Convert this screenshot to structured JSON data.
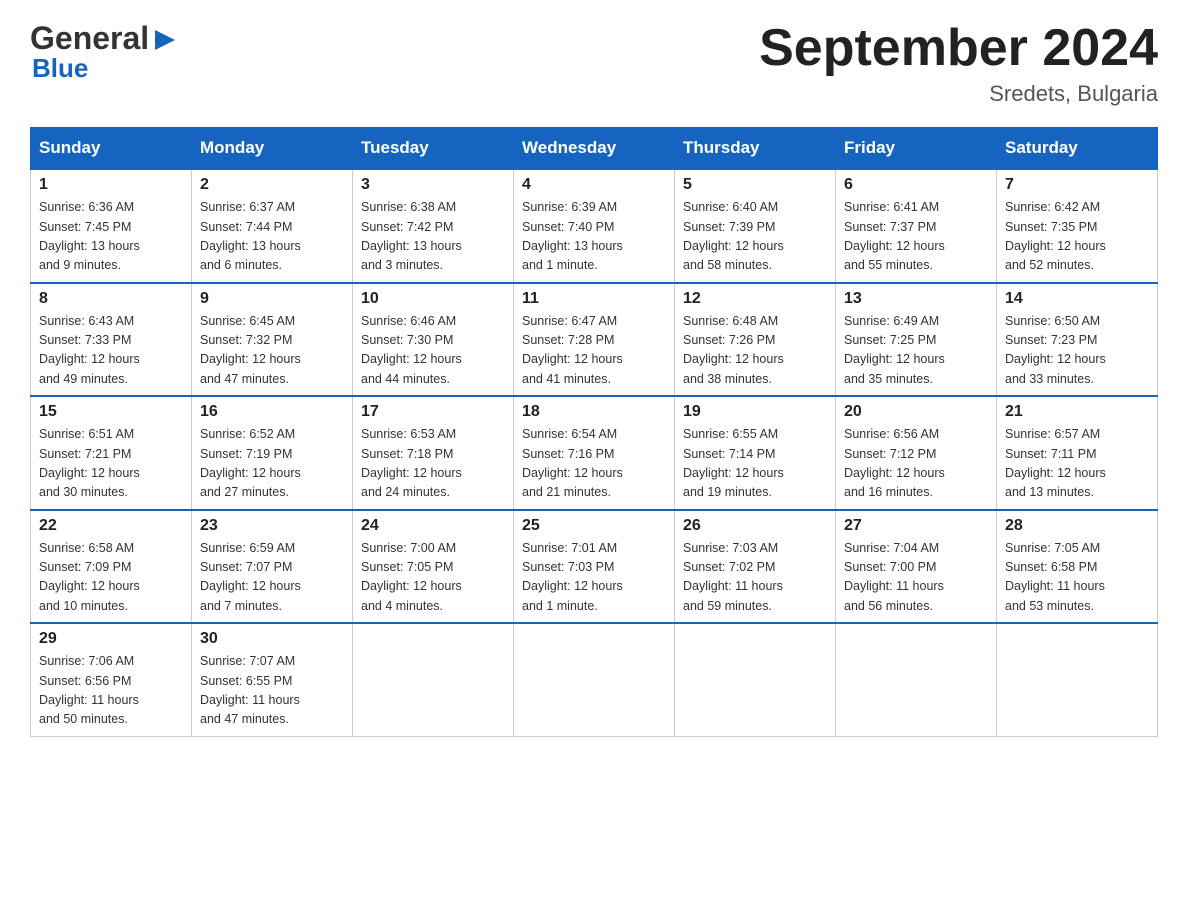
{
  "header": {
    "logo_general": "General",
    "logo_blue": "Blue",
    "title": "September 2024",
    "location": "Sredets, Bulgaria"
  },
  "weekdays": [
    "Sunday",
    "Monday",
    "Tuesday",
    "Wednesday",
    "Thursday",
    "Friday",
    "Saturday"
  ],
  "weeks": [
    [
      {
        "day": "1",
        "info": "Sunrise: 6:36 AM\nSunset: 7:45 PM\nDaylight: 13 hours\nand 9 minutes."
      },
      {
        "day": "2",
        "info": "Sunrise: 6:37 AM\nSunset: 7:44 PM\nDaylight: 13 hours\nand 6 minutes."
      },
      {
        "day": "3",
        "info": "Sunrise: 6:38 AM\nSunset: 7:42 PM\nDaylight: 13 hours\nand 3 minutes."
      },
      {
        "day": "4",
        "info": "Sunrise: 6:39 AM\nSunset: 7:40 PM\nDaylight: 13 hours\nand 1 minute."
      },
      {
        "day": "5",
        "info": "Sunrise: 6:40 AM\nSunset: 7:39 PM\nDaylight: 12 hours\nand 58 minutes."
      },
      {
        "day": "6",
        "info": "Sunrise: 6:41 AM\nSunset: 7:37 PM\nDaylight: 12 hours\nand 55 minutes."
      },
      {
        "day": "7",
        "info": "Sunrise: 6:42 AM\nSunset: 7:35 PM\nDaylight: 12 hours\nand 52 minutes."
      }
    ],
    [
      {
        "day": "8",
        "info": "Sunrise: 6:43 AM\nSunset: 7:33 PM\nDaylight: 12 hours\nand 49 minutes."
      },
      {
        "day": "9",
        "info": "Sunrise: 6:45 AM\nSunset: 7:32 PM\nDaylight: 12 hours\nand 47 minutes."
      },
      {
        "day": "10",
        "info": "Sunrise: 6:46 AM\nSunset: 7:30 PM\nDaylight: 12 hours\nand 44 minutes."
      },
      {
        "day": "11",
        "info": "Sunrise: 6:47 AM\nSunset: 7:28 PM\nDaylight: 12 hours\nand 41 minutes."
      },
      {
        "day": "12",
        "info": "Sunrise: 6:48 AM\nSunset: 7:26 PM\nDaylight: 12 hours\nand 38 minutes."
      },
      {
        "day": "13",
        "info": "Sunrise: 6:49 AM\nSunset: 7:25 PM\nDaylight: 12 hours\nand 35 minutes."
      },
      {
        "day": "14",
        "info": "Sunrise: 6:50 AM\nSunset: 7:23 PM\nDaylight: 12 hours\nand 33 minutes."
      }
    ],
    [
      {
        "day": "15",
        "info": "Sunrise: 6:51 AM\nSunset: 7:21 PM\nDaylight: 12 hours\nand 30 minutes."
      },
      {
        "day": "16",
        "info": "Sunrise: 6:52 AM\nSunset: 7:19 PM\nDaylight: 12 hours\nand 27 minutes."
      },
      {
        "day": "17",
        "info": "Sunrise: 6:53 AM\nSunset: 7:18 PM\nDaylight: 12 hours\nand 24 minutes."
      },
      {
        "day": "18",
        "info": "Sunrise: 6:54 AM\nSunset: 7:16 PM\nDaylight: 12 hours\nand 21 minutes."
      },
      {
        "day": "19",
        "info": "Sunrise: 6:55 AM\nSunset: 7:14 PM\nDaylight: 12 hours\nand 19 minutes."
      },
      {
        "day": "20",
        "info": "Sunrise: 6:56 AM\nSunset: 7:12 PM\nDaylight: 12 hours\nand 16 minutes."
      },
      {
        "day": "21",
        "info": "Sunrise: 6:57 AM\nSunset: 7:11 PM\nDaylight: 12 hours\nand 13 minutes."
      }
    ],
    [
      {
        "day": "22",
        "info": "Sunrise: 6:58 AM\nSunset: 7:09 PM\nDaylight: 12 hours\nand 10 minutes."
      },
      {
        "day": "23",
        "info": "Sunrise: 6:59 AM\nSunset: 7:07 PM\nDaylight: 12 hours\nand 7 minutes."
      },
      {
        "day": "24",
        "info": "Sunrise: 7:00 AM\nSunset: 7:05 PM\nDaylight: 12 hours\nand 4 minutes."
      },
      {
        "day": "25",
        "info": "Sunrise: 7:01 AM\nSunset: 7:03 PM\nDaylight: 12 hours\nand 1 minute."
      },
      {
        "day": "26",
        "info": "Sunrise: 7:03 AM\nSunset: 7:02 PM\nDaylight: 11 hours\nand 59 minutes."
      },
      {
        "day": "27",
        "info": "Sunrise: 7:04 AM\nSunset: 7:00 PM\nDaylight: 11 hours\nand 56 minutes."
      },
      {
        "day": "28",
        "info": "Sunrise: 7:05 AM\nSunset: 6:58 PM\nDaylight: 11 hours\nand 53 minutes."
      }
    ],
    [
      {
        "day": "29",
        "info": "Sunrise: 7:06 AM\nSunset: 6:56 PM\nDaylight: 11 hours\nand 50 minutes."
      },
      {
        "day": "30",
        "info": "Sunrise: 7:07 AM\nSunset: 6:55 PM\nDaylight: 11 hours\nand 47 minutes."
      },
      null,
      null,
      null,
      null,
      null
    ]
  ]
}
